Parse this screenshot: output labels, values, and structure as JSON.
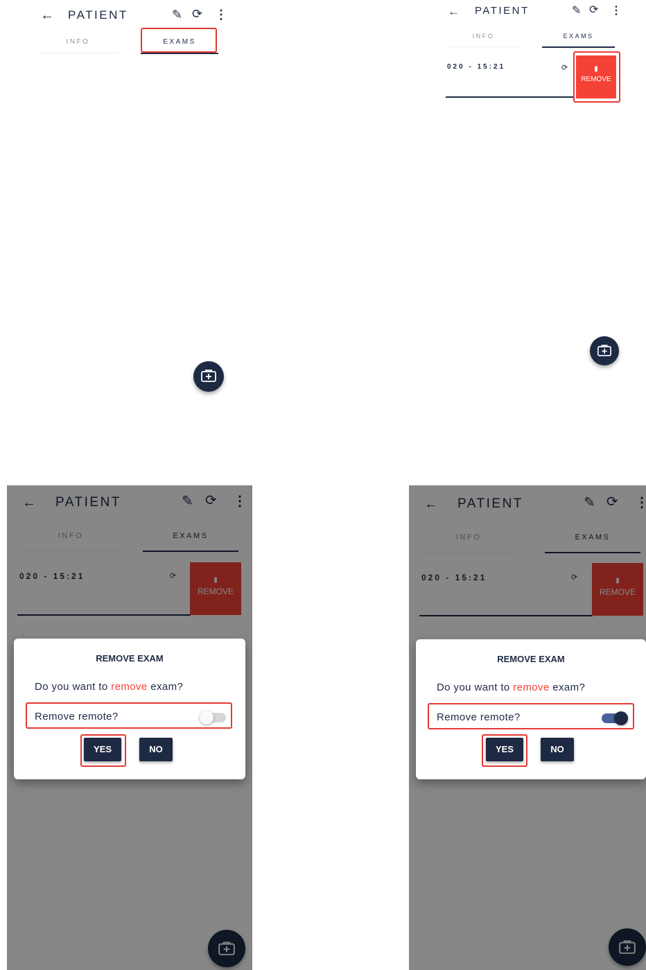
{
  "screen": {
    "title": "PATIENT",
    "tabs": {
      "info": "INFO",
      "exams": "EXAMS"
    },
    "exam_row": {
      "time": "020 - 15:21"
    },
    "remove_action": {
      "label": "REMOVE"
    }
  },
  "dialog": {
    "title": "REMOVE EXAM",
    "message_before": "Do you want to ",
    "message_highlight": "remove",
    "message_after": " exam?",
    "toggle_label": "Remove remote?",
    "yes_label": "YES",
    "no_label": "NO"
  },
  "states": {
    "panel3_remote_toggle": "off",
    "panel4_remote_toggle": "on"
  },
  "icons": [
    "back-arrow-icon",
    "pencil-icon",
    "sync-icon",
    "more-vert-icon",
    "trash-icon",
    "medical-kit-icon"
  ],
  "colors": {
    "primary": "#1e2a44",
    "danger": "#f44336",
    "highlight": "#e53935",
    "overlay": "rgba(0,0,0,0.47)"
  }
}
